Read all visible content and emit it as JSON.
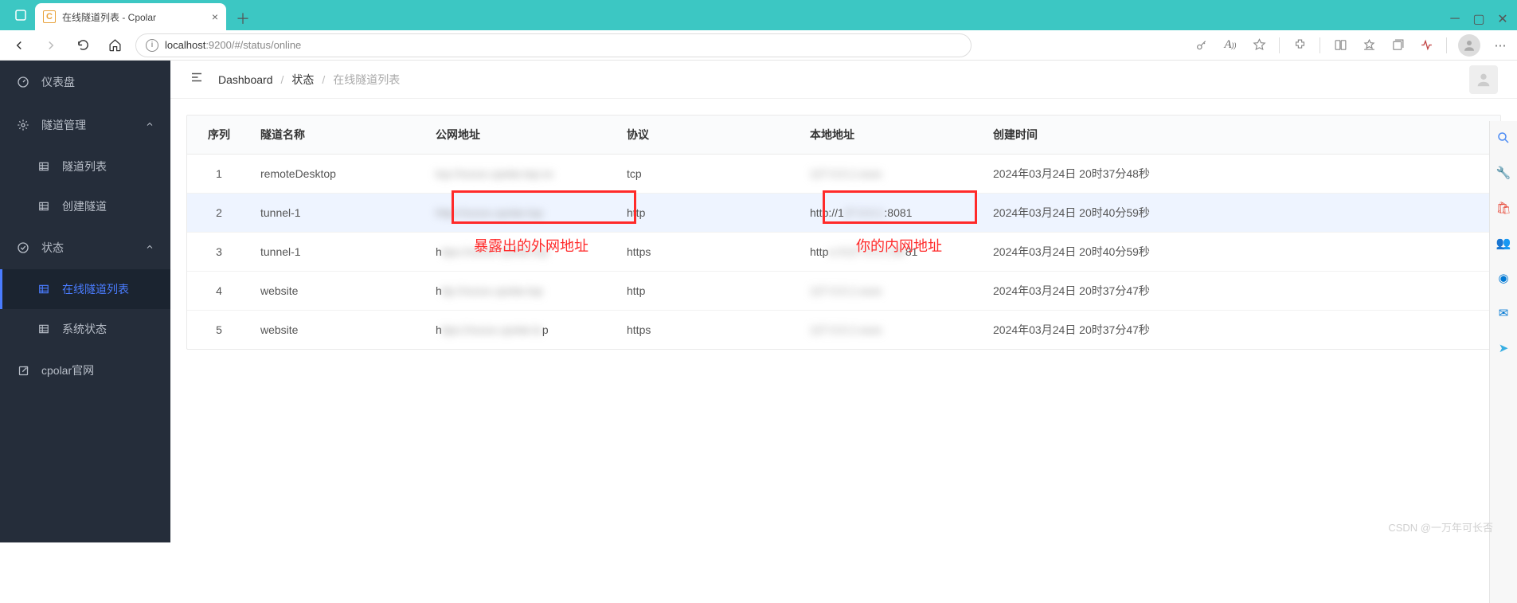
{
  "browser": {
    "tab_title": "在线隧道列表 - Cpolar",
    "favicon_letter": "C",
    "url_host": "localhost",
    "url_port_path": ":9200/#/status/online"
  },
  "sidebar": {
    "dashboard": "仪表盘",
    "tunnel_mgmt": "隧道管理",
    "tunnel_list": "隧道列表",
    "create_tunnel": "创建隧道",
    "status": "状态",
    "online_list": "在线隧道列表",
    "system_status": "系统状态",
    "cpolar_site": "cpolar官网"
  },
  "breadcrumb": {
    "dashboard": "Dashboard",
    "status": "状态",
    "current": "在线隧道列表"
  },
  "table": {
    "headers": {
      "index": "序列",
      "name": "隧道名称",
      "public": "公网地址",
      "protocol": "协议",
      "local": "本地地址",
      "created": "创建时间"
    },
    "rows": [
      {
        "idx": "1",
        "name": "remoteDesktop",
        "public": "tcp://xxxxx.cpolar.top:xx",
        "protocol": "tcp",
        "local": "127.0.0.1:xxxx",
        "created": "2024年03月24日 20时37分48秒"
      },
      {
        "idx": "2",
        "name": "tunnel-1",
        "public": "http://xxxxx.cpolar.top",
        "protocol": "http",
        "local_prefix": "http://1",
        "local_suffix": ":8081",
        "local_mid": "27.0.0.1",
        "created": "2024年03月24日 20时40分59秒"
      },
      {
        "idx": "3",
        "name": "tunnel-1",
        "public_prefix": "h",
        "public_blur": "ttps://xxxxx.cpolar.top",
        "protocol": "https",
        "local_prefix": "http",
        "local_blur": "s://127.0.0.1:80",
        "local_suffix": "81",
        "created": "2024年03月24日 20时40分59秒"
      },
      {
        "idx": "4",
        "name": "website",
        "public_prefix": "h",
        "public_blur": "ttp://xxxxx.cpolar.top",
        "protocol": "http",
        "local": "127.0.0.1:xxxx",
        "created": "2024年03月24日 20时37分47秒"
      },
      {
        "idx": "5",
        "name": "website",
        "public_prefix": "h",
        "public_blur": "ttps://xxxxx.cpolar.to",
        "public_suffix": "p",
        "protocol": "https",
        "local": "127.0.0.1:xxxx",
        "created": "2024年03月24日 20时37分47秒"
      }
    ]
  },
  "annotations": {
    "public_label": "暴露出的外网地址",
    "local_label": "你的内网地址"
  },
  "watermark": "CSDN @一万年可长否"
}
